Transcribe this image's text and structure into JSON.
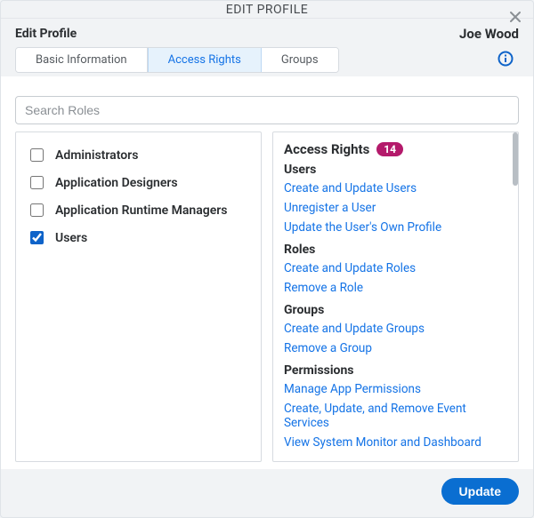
{
  "dialog": {
    "title": "EDIT PROFILE",
    "subtitle_left": "Edit Profile",
    "subtitle_right": "Joe Wood"
  },
  "tabs": [
    {
      "label": "Basic Information",
      "active": false
    },
    {
      "label": "Access Rights",
      "active": true
    },
    {
      "label": "Groups",
      "active": false
    }
  ],
  "search": {
    "placeholder": "Search Roles",
    "value": ""
  },
  "roles": [
    {
      "label": "Administrators",
      "checked": false
    },
    {
      "label": "Application Designers",
      "checked": false
    },
    {
      "label": "Application Runtime Managers",
      "checked": false
    },
    {
      "label": "Users",
      "checked": true
    }
  ],
  "access_rights": {
    "header": "Access Rights",
    "count": "14",
    "sections": [
      {
        "title": "Users",
        "items": [
          "Create and Update Users",
          "Unregister a User",
          "Update the User's Own Profile"
        ]
      },
      {
        "title": "Roles",
        "items": [
          "Create and Update Roles",
          "Remove a Role"
        ]
      },
      {
        "title": "Groups",
        "items": [
          "Create and Update Groups",
          "Remove a Group"
        ]
      },
      {
        "title": "Permissions",
        "items": [
          "Manage App Permissions",
          "Create, Update, and Remove Event Services",
          "View System Monitor and Dashboard"
        ]
      }
    ]
  },
  "footer": {
    "update_label": "Update"
  },
  "colors": {
    "accent": "#0a6ed1",
    "link": "#1473e6",
    "badge": "#b41a6b"
  }
}
